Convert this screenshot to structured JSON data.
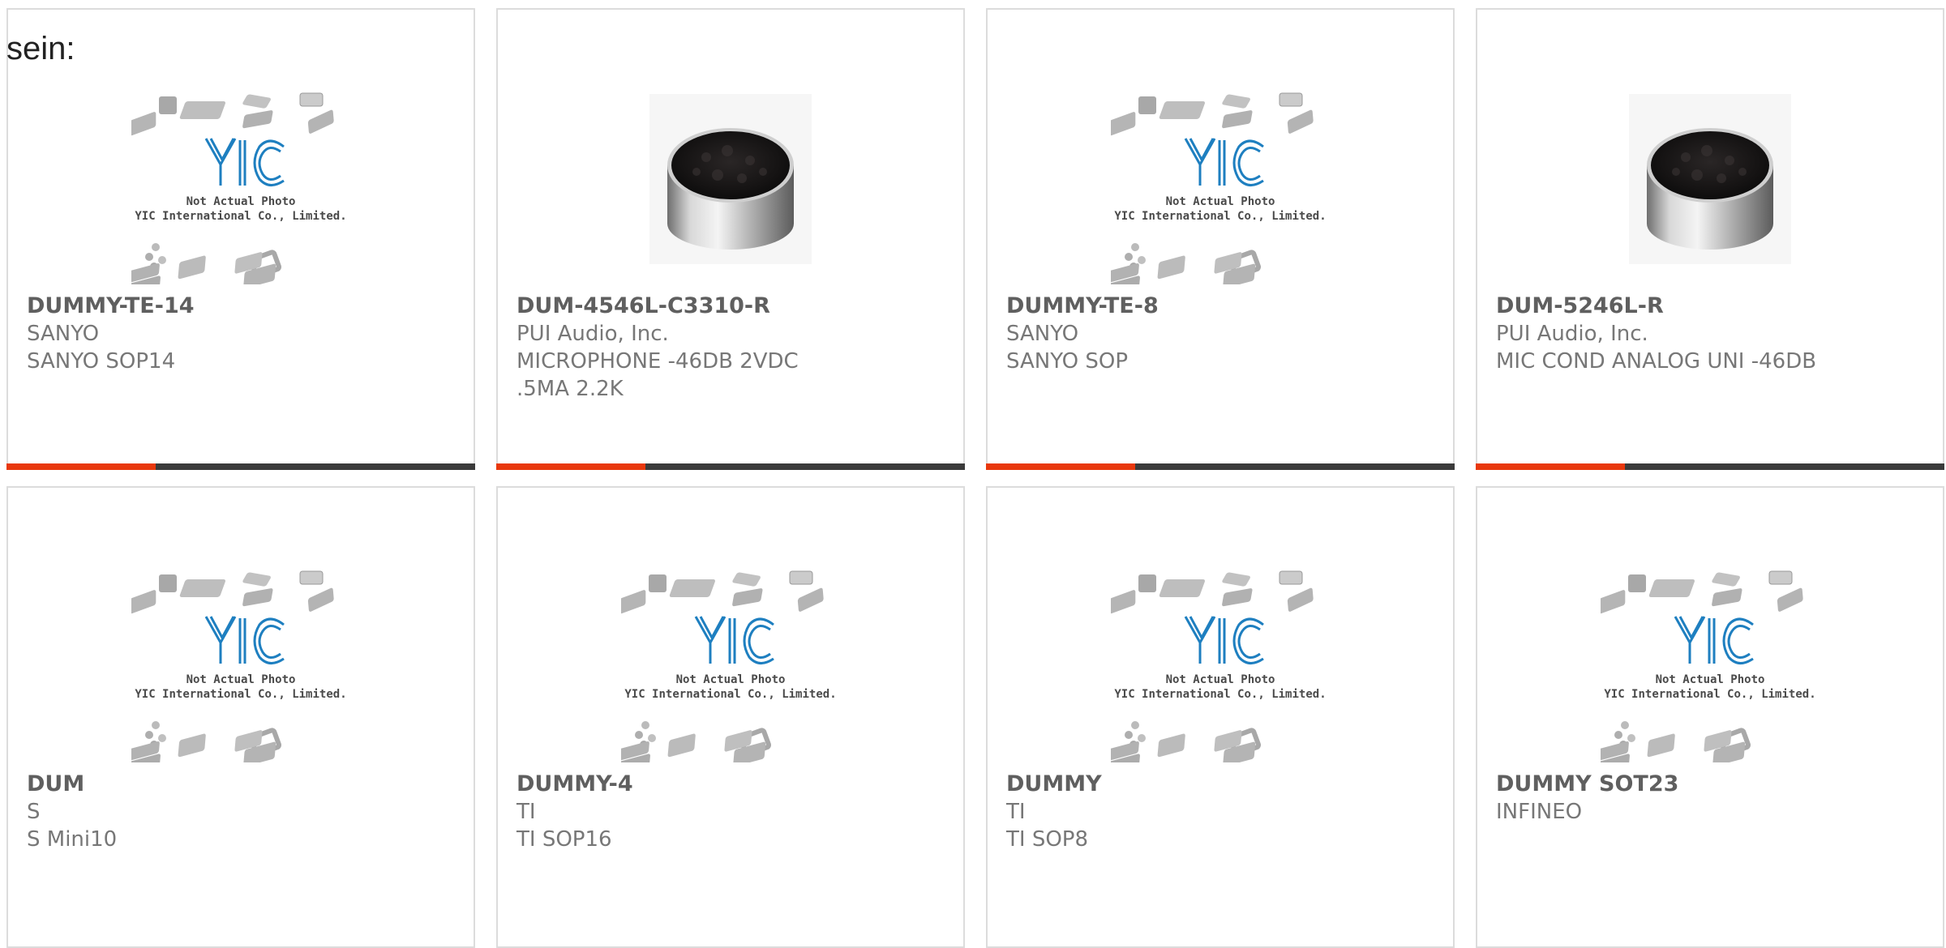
{
  "intro_text": "sein:",
  "placeholder_image": {
    "line1": "Not Actual Photo",
    "line2": "YIC International Co., Limited.",
    "logo_text": "YIC"
  },
  "products": [
    {
      "part_number": "DUMMY-TE-14",
      "manufacturer": "SANYO",
      "description": "SANYO SOP14",
      "image": "yic-placeholder"
    },
    {
      "part_number": "DUM-4546L-C3310-R",
      "manufacturer": "PUI Audio, Inc.",
      "description": "MICROPHONE -46DB 2VDC .5MA 2.2K",
      "image": "microphone-photo"
    },
    {
      "part_number": "DUMMY-TE-8",
      "manufacturer": "SANYO",
      "description": "SANYO SOP",
      "image": "yic-placeholder"
    },
    {
      "part_number": "DUM-5246L-R",
      "manufacturer": "PUI Audio, Inc.",
      "description": "MIC COND ANALOG UNI -46DB",
      "image": "microphone-photo"
    },
    {
      "part_number": "DUM",
      "manufacturer": "S",
      "description": "S Mini10",
      "image": "yic-placeholder"
    },
    {
      "part_number": "DUMMY-4",
      "manufacturer": "TI",
      "description": "TI SOP16",
      "image": "yic-placeholder"
    },
    {
      "part_number": "DUMMY",
      "manufacturer": "TI",
      "description": "TI SOP8",
      "image": "yic-placeholder"
    },
    {
      "part_number": "DUMMY SOT23",
      "manufacturer": "INFINEO",
      "description": "",
      "image": "yic-placeholder"
    }
  ],
  "colors": {
    "accent": "#e8380d",
    "bar": "#3b3b3b",
    "logo_blue": "#1e7fc0",
    "card_border": "#dcdcdc"
  }
}
